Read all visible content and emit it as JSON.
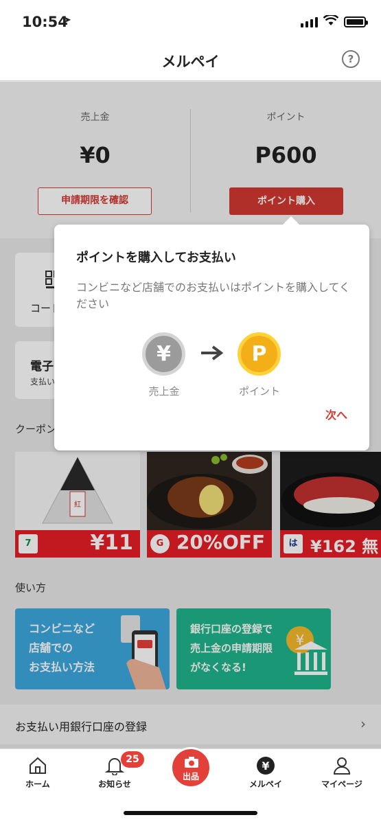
{
  "status": {
    "time": "10:54"
  },
  "nav": {
    "title": "メルペイ",
    "help": "?"
  },
  "balance": {
    "sales_label": "売上金",
    "sales_value": "¥0",
    "sales_button": "申請期限を確認",
    "points_label": "ポイント",
    "points_value": "P600",
    "points_button": "ポイント購入"
  },
  "cards": {
    "code_label": "コード",
    "emoney_title": "電子",
    "emoney_sub": "支払い"
  },
  "coupons": {
    "section_title": "クーポン",
    "items": [
      {
        "logo": "7",
        "price": "¥11",
        "color": "#e61e25"
      },
      {
        "logo": "G",
        "price": "20%OFF",
        "color": "#e61e25"
      },
      {
        "logo": "は",
        "price": "¥162 無",
        "color": "#e61e25"
      }
    ]
  },
  "howto": {
    "section_title": "使い方",
    "card1": "コンビニなど店舗でのお支払い方法",
    "card1_line1": "コンビニなど",
    "card1_line2": "店舗での",
    "card1_line3": "お支払い方法",
    "card2_line1": "銀行口座の登録で",
    "card2_line2": "売上金の申請期限",
    "card2_line3": "がなくなる!"
  },
  "bank_row": {
    "label": "お支払い用銀行口座の登録"
  },
  "popup": {
    "title": "ポイントを購入してお支払い",
    "body": "コンビニなど店舗でのお支払いはポイントを購入してください",
    "from_label": "売上金",
    "to_label": "ポイント",
    "yen_symbol": "¥",
    "p_symbol": "P",
    "next": "次へ"
  },
  "tabbar": {
    "home": "ホーム",
    "notifications": "お知らせ",
    "badge": "25",
    "sell": "出品",
    "merpay": "メルペイ",
    "mypage": "マイページ"
  }
}
